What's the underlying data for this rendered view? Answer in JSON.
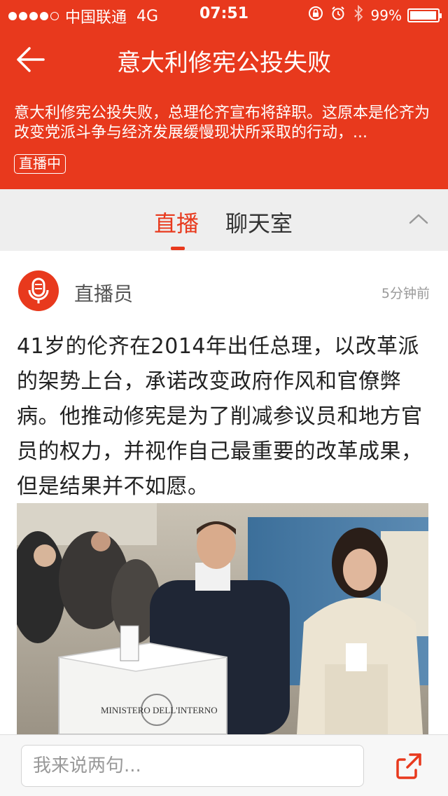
{
  "status_bar": {
    "carrier": "中国联通",
    "network": "4G",
    "time": "07:51",
    "battery": "99%",
    "battery_level": 0.99,
    "signal_bars": 4
  },
  "nav": {
    "title": "意大利修宪公投失败",
    "back_icon": "arrow-left-icon"
  },
  "summary": {
    "text": "意大利修宪公投失败，总理伦齐宣布将辞职。这原本是伦齐为改变党派斗争与经济发展缓慢现状所采取的行动，...",
    "badge": "直播中"
  },
  "tabs": [
    {
      "label": "直播",
      "active": true
    },
    {
      "label": "聊天室",
      "active": false
    }
  ],
  "post": {
    "author": "直播员",
    "time": "5分钟前",
    "avatar_icon": "microphone-icon",
    "text": "41岁的伦齐在2014年出任总理，以改革派的架势上台，承诺改变政府作风和官僚弊病。他推动修宪是为了削减参议员和地方官员的权力，并视作自己最重要的改革成果，但是结果并不如愿。",
    "photo_caption_text": "MINISTERO DELL'INTERNO"
  },
  "bottom_bar": {
    "placeholder": "我来说两句...",
    "share_icon": "share-icon"
  },
  "colors": {
    "accent": "#e8391d",
    "text": "#222222",
    "muted": "#999999"
  }
}
